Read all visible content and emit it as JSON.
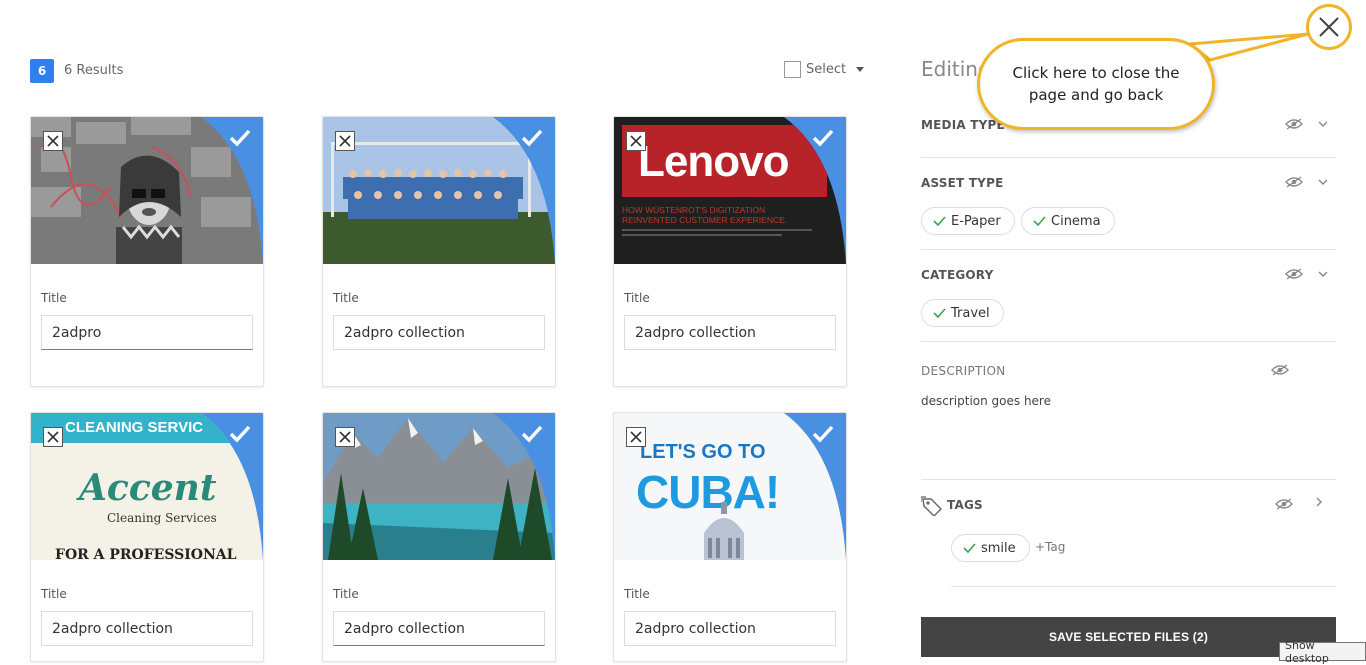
{
  "results": {
    "count": "6",
    "label": "6 Results"
  },
  "select": {
    "label": "Select"
  },
  "cards": [
    {
      "title_label": "Title",
      "title_value": "2adpro"
    },
    {
      "title_label": "Title",
      "title_value": "2adpro collection"
    },
    {
      "title_label": "Title",
      "title_value": "2adpro collection"
    },
    {
      "title_label": "Title",
      "title_value": "2adpro collection"
    },
    {
      "title_label": "Title",
      "title_value": "2adpro collection"
    },
    {
      "title_label": "Title",
      "title_value": "2adpro collection"
    }
  ],
  "thumbs": {
    "lenovo": "Lenovo",
    "lenovo_sub1": "HOW WÜSTENROT'S DIGITIZATION",
    "lenovo_sub2": "REINVENTED CUSTOMER EXPERIENCE.",
    "cleaning_top": "CLEANING SERVIC",
    "cleaning_script": "Accent",
    "cleaning_sub": "Cleaning Services",
    "cleaning_bottom": "FOR A PROFESSIONAL",
    "cuba_top": "LET'S GO TO",
    "cuba_big": "CUBA!"
  },
  "panel": {
    "title": "Editing",
    "media_type": "MEDIA TYPE",
    "asset_type": "ASSET TYPE",
    "asset_chips": [
      "E-Paper",
      "Cinema"
    ],
    "category": "CATEGORY",
    "category_chips": [
      "Travel"
    ],
    "description_label": "DESCRIPTION",
    "description_text": "description goes here",
    "tags_label": "TAGS",
    "tag_chips": [
      "smile"
    ],
    "add_tag": "+Tag",
    "save_button": "SAVE SELECTED FILES (2)"
  },
  "callout": {
    "text": "Click here to close the page and go back"
  },
  "tooltip": "Show desktop",
  "colors": {
    "accent_blue": "#4a90e2",
    "badge_blue": "#2f80ed",
    "callout_border": "#f0b429",
    "save_bg": "#444444",
    "check_green": "#3aa54b"
  },
  "icons": [
    "check-icon",
    "close-icon",
    "eye-icon",
    "chevron-down-icon",
    "chevron-right-icon",
    "tag-icon",
    "caret-down-icon"
  ]
}
